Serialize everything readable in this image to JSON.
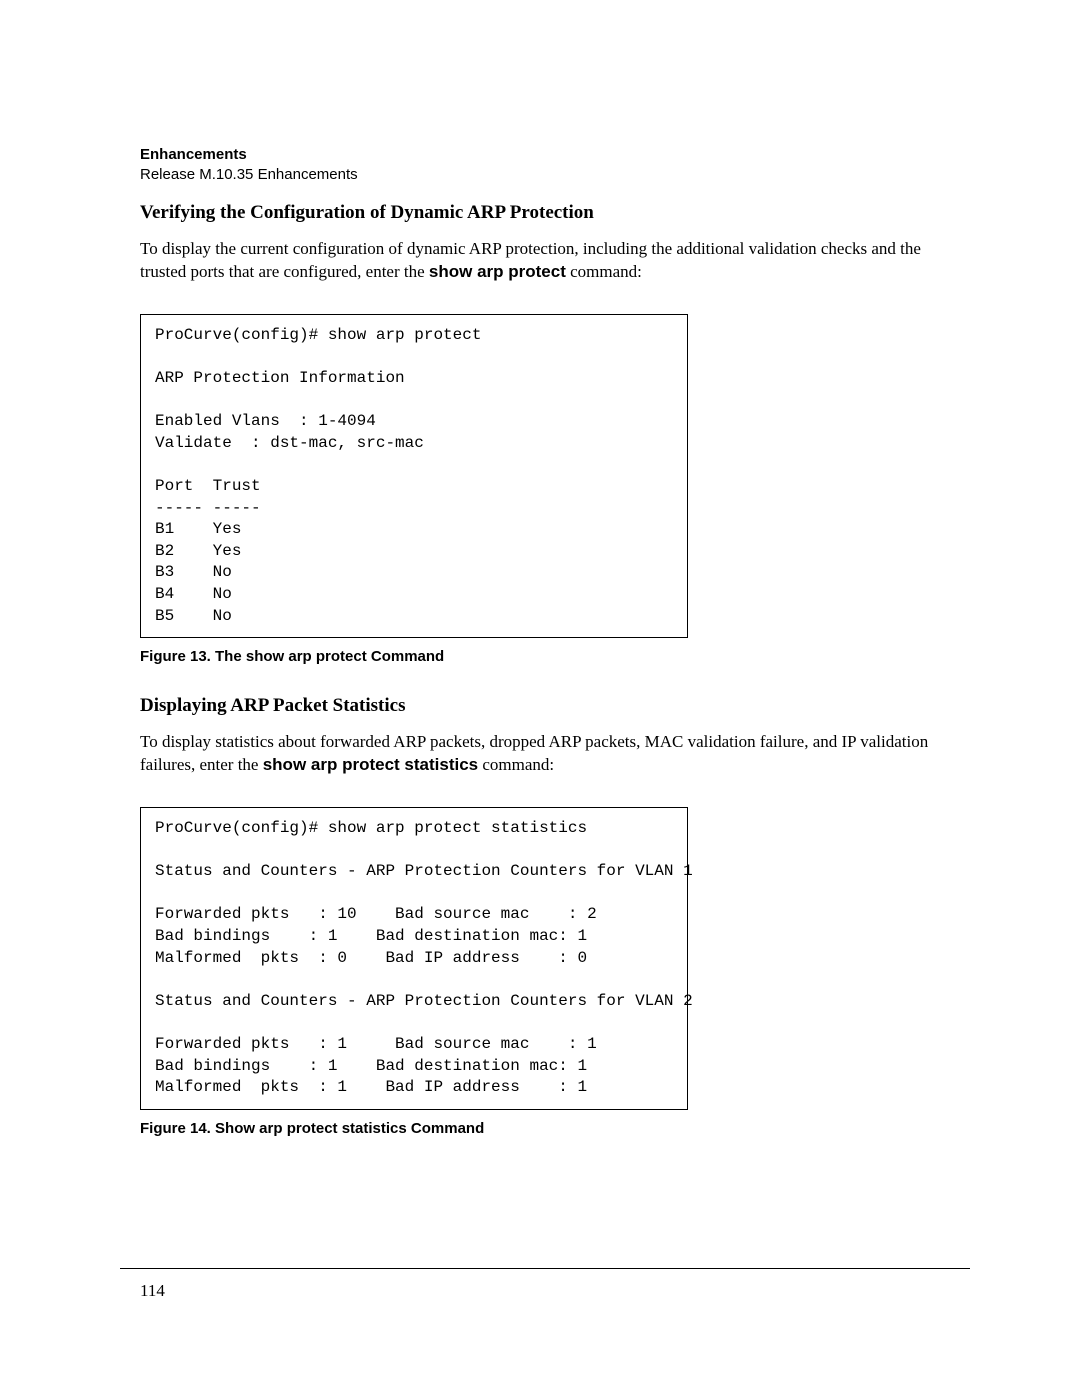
{
  "header": {
    "bold": "Enhancements",
    "sub": "Release M.10.35 Enhancements"
  },
  "section1": {
    "heading": "Verifying the Configuration of Dynamic ARP Protection",
    "para_pre": "To display the current configuration of dynamic ARP protection, including the additional validation checks and the trusted ports that are configured, enter the ",
    "cmd": "show arp protect",
    "para_post": " command:"
  },
  "code1": "ProCurve(config)# show arp protect\n\nARP Protection Information\n\nEnabled Vlans  : 1-4094\nValidate  : dst-mac, src-mac\n\nPort  Trust\n----- -----\nB1    Yes\nB2    Yes\nB3    No\nB4    No\nB5    No",
  "figure1": "Figure 13. The show arp protect Command",
  "section2": {
    "heading": "Displaying ARP Packet Statistics",
    "para_pre": "To display statistics about forwarded ARP packets, dropped ARP packets, MAC validation failure, and IP validation failures, enter the ",
    "cmd": "show arp protect statistics",
    "para_post": " command:"
  },
  "code2": "ProCurve(config)# show arp protect statistics\n\nStatus and Counters - ARP Protection Counters for VLAN 1\n\nForwarded pkts   : 10    Bad source mac    : 2\nBad bindings    : 1    Bad destination mac: 1\nMalformed  pkts  : 0    Bad IP address    : 0\n\nStatus and Counters - ARP Protection Counters for VLAN 2\n\nForwarded pkts   : 1     Bad source mac    : 1\nBad bindings    : 1    Bad destination mac: 1\nMalformed  pkts  : 1    Bad IP address    : 1",
  "figure2": "Figure 14. Show arp protect statistics Command",
  "page_number": "114"
}
